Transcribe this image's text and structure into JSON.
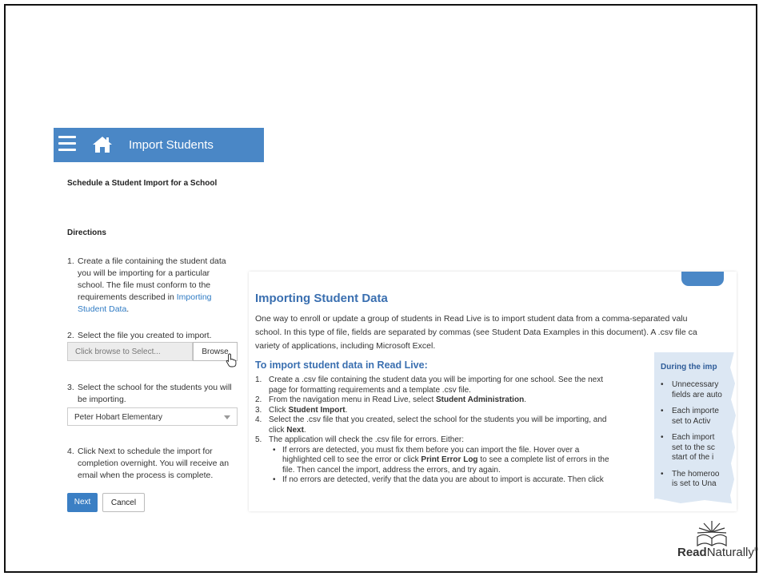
{
  "topbar": {
    "title": "Import Students"
  },
  "heading": "Schedule a Student Import for a School",
  "directions_label": "Directions",
  "step1": {
    "line1": "Create a file containing the student data",
    "line2": "you will be importing for a particular",
    "line3": "school. The file must conform to the",
    "line4_prefix": "requirements described in ",
    "link_part1": "Importing",
    "link_part2": "Student Data",
    "suffix": "."
  },
  "step2": {
    "text": "Select the file you created to import.",
    "file_placeholder": "Click browse to Select...",
    "browse_label": "Browse"
  },
  "step3": {
    "line1": "Select the school for the students you will",
    "line2": "be importing.",
    "selected_school": "Peter Hobart Elementary"
  },
  "step4": {
    "line1": "Click Next to schedule the import for",
    "line2": "completion overnight. You will receive an",
    "line3": "email when the process is complete."
  },
  "buttons": {
    "next": "Next",
    "cancel": "Cancel"
  },
  "numbers": {
    "n1": "1.",
    "n2": "2.",
    "n3": "3.",
    "n4": "4."
  },
  "doc": {
    "title": "Importing Student Data",
    "intro1": "One way to enroll or update a group of students in Read Live is to import student data from a comma-separated valu",
    "intro2": "school. In this type of file, fields are separated by commas (see Student Data Examples in this document).  A .csv file ca",
    "intro3": "variety of applications, including Microsoft Excel.",
    "subtitle": "To import student data in Read Live:",
    "s1a": "Create a .csv file containing the student data you will be importing for one school. See the next",
    "s1b": "page for formatting requirements and a template .csv file.",
    "s2a": "From the navigation menu in Read Live, select ",
    "s2b": "Student Administration",
    "s3a": "Click ",
    "s3b": "Student Import",
    "s4a": "Select the .csv file that you created, select the school for the students you will be importing, and",
    "s4b": "click ",
    "s4c": "Next",
    "s5": "The application will check the .csv file for errors. Either:",
    "b1a": "If errors are detected, you must fix them before you can import the file. Hover over a",
    "b1b": "highlighted cell to see the error or click ",
    "b1c": "Print Error Log",
    "b1d": " to see a complete list of errors in the",
    "b1e": "file.  Then cancel the import, address the errors, and try again.",
    "b2": "If no errors are detected, verify that the data you are about to import is accurate.  Then click",
    "period": ".",
    "nums": {
      "a": "1.",
      "b": "2.",
      "c": "3.",
      "d": "4.",
      "e": "5."
    },
    "bullet": "•",
    "sidebox": {
      "title": "During the imp",
      "i1a": "Unnecessary ",
      "i1b": "fields are auto",
      "i2a": "Each importe",
      "i2b": "set to Activ",
      "i3a": "Each import",
      "i3b": "set to the sc",
      "i3c": "start of the i",
      "i4a": "The homeroo",
      "i4b": "is set to Una"
    }
  },
  "logo": {
    "bold": "Read",
    "regular": "Naturally",
    "mark": "®"
  }
}
